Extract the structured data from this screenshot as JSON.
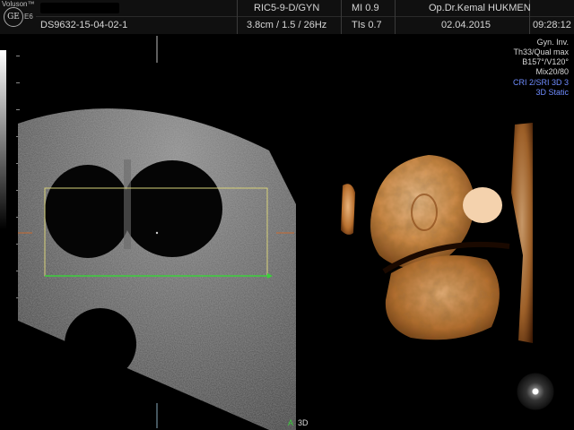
{
  "header": {
    "brand": "Voluson™",
    "model": "E6",
    "logo_text": "GE",
    "patient_id": "DS9632-15-04-02-1",
    "probe": "RIC5-9-D/GYN",
    "mi": "MI 0.9",
    "operator": "Op.Dr.Kemal HUKMEN",
    "depth_freq": "3.8cm / 1.5 / 26Hz",
    "tis": "TIs 0.7",
    "date": "02.04.2015",
    "time": "09:28:12"
  },
  "side_info": [
    {
      "text": "Gyn. Inv.",
      "color": "white"
    },
    {
      "text": "Th33/Qual max",
      "color": "white"
    },
    {
      "text": "B157°/V120°",
      "color": "white"
    },
    {
      "text": "Mix20/80",
      "color": "white"
    },
    {
      "text": "CRI 2/SRI 3D 3",
      "color": "blue"
    },
    {
      "text": "3D Static",
      "color": "blue"
    }
  ],
  "bottom_marker": {
    "label": "A",
    "mode": "3D"
  },
  "colors": {
    "roi_box": "#d8d27a",
    "roi_line": "#3ccf3c",
    "render": "#d89040",
    "depth_marker": "#c86a30"
  },
  "icons": [
    "ge-logo-icon",
    "probe-orientation-icon",
    "grey-scale-bar"
  ]
}
